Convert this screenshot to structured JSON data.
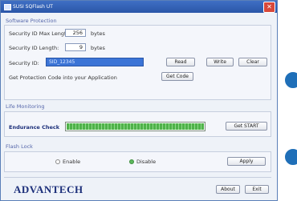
{
  "window": {
    "title": "SUSI SQFlash UT"
  },
  "protection": {
    "section_title": "Software Protection",
    "max_len_label": "Security ID Max Length:",
    "max_len_value": "256",
    "max_len_unit": "bytes",
    "len_label": "Security ID Length:",
    "len_value": "9",
    "len_unit": "bytes",
    "id_label": "Security ID:",
    "id_value": "SID_12345",
    "read_label": "Read",
    "write_label": "Write",
    "clear_label": "Clear",
    "code_label": "Get Protection Code into your Application",
    "get_code_label": "Get Code"
  },
  "life": {
    "section_title": "Life Monitoring",
    "endurance_label": "Endurance Check",
    "progress_percent": 100,
    "progress_color": "#4fb24a",
    "get_start_label": "Get START"
  },
  "flash_lock": {
    "section_title": "Flash Lock",
    "enable_label": "Enable",
    "disable_label": "Disable",
    "selected": "Disable",
    "apply_label": "Apply"
  },
  "footer": {
    "logo": "ADVANTECH",
    "about_label": "About",
    "exit_label": "Exit"
  },
  "colors": {
    "accent": "#2a56a8",
    "selection": "#3b74d6",
    "brand": "#1c2f7a"
  }
}
